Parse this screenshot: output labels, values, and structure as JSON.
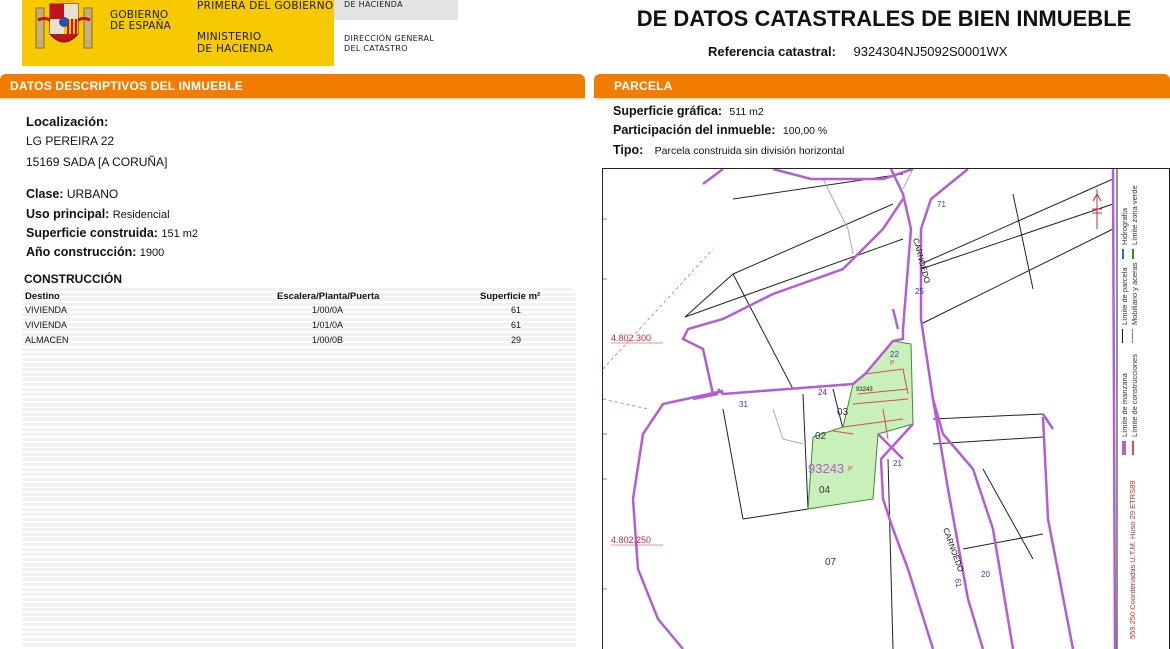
{
  "header": {
    "gobierno_line1": "GOBIERNO",
    "gobierno_line2": "DE ESPAÑA",
    "ministerio_top": "PRIMERA DEL GOBIERNO",
    "ministerio_line1": "MINISTERIO",
    "ministerio_line2": "DE HACIENDA",
    "dg_top": "DE HACIENDA",
    "dg_line1": "DIRECCIÓN GENERAL",
    "dg_line2": "DEL CATASTRO",
    "title": "DE DATOS CATASTRALES DE BIEN INMUEBLE",
    "ref_label": "Referencia catastral:",
    "ref_value": "9324304NJ5092S0001WX"
  },
  "left": {
    "section_title": "DATOS DESCRIPTIVOS DEL INMUEBLE",
    "localizacion_label": "Localización:",
    "address1": "LG PEREIRA 22",
    "address2": "15169 SADA [A CORUÑA]",
    "clase_label": "Clase:",
    "clase_value": "URBANO",
    "uso_label": "Uso principal:",
    "uso_value": "Residencial",
    "superficie_label": "Superficie construida:",
    "superficie_value": "151 m2",
    "anio_label": "Año construcción:",
    "anio_value": "1900",
    "construccion_title": "CONSTRUCCIÓN",
    "table": {
      "headers": [
        "Destino",
        "Escalera/Planta/Puerta",
        "Superficie m²"
      ],
      "rows": [
        [
          "VIVIENDA",
          "1/00/0A",
          "61"
        ],
        [
          "VIVIENDA",
          "1/01/0A",
          "61"
        ],
        [
          "ALMACEN",
          "1/00/0B",
          "29"
        ]
      ]
    }
  },
  "right": {
    "section_title": "PARCELA",
    "sup_grafica_label": "Superficie gráfica:",
    "sup_grafica_value": "511 m2",
    "participacion_label": "Participación del inmueble:",
    "participacion_value": "100,00 %",
    "tipo_label": "Tipo:",
    "tipo_value": "Parcela construida sin división horizontal"
  },
  "map": {
    "coord_1": "4.802.300",
    "coord_2": "4.802.250",
    "parcel_code": "93243",
    "parcel_small_code": "93243",
    "street_name_1": "CARNOEDO",
    "street_name_2": "CARNOEDO",
    "number_labels": [
      "22",
      "24",
      "31",
      "21",
      "71",
      "61",
      "20",
      "25"
    ],
    "parcel_numbers": [
      "03",
      "02",
      "04",
      "07"
    ],
    "p_labels": [
      "P",
      "P"
    ],
    "legend": {
      "manzana": "Límite de manzana",
      "construcciones": "Límite de construcciones",
      "parcela": "Límite de parcela",
      "mobiliario": "Mobiliario y aceras",
      "hidrografia": "Hidrografía",
      "zona_verde": "Límite zona verde",
      "utm": "559.250 Coordenadas U.T.M. Huso 29 ETRS89"
    },
    "colors": {
      "manzana": "#b060d0",
      "construcciones": "#d05050",
      "parcela_fill": "#c8f0b8",
      "coord_text": "#c03030"
    }
  }
}
